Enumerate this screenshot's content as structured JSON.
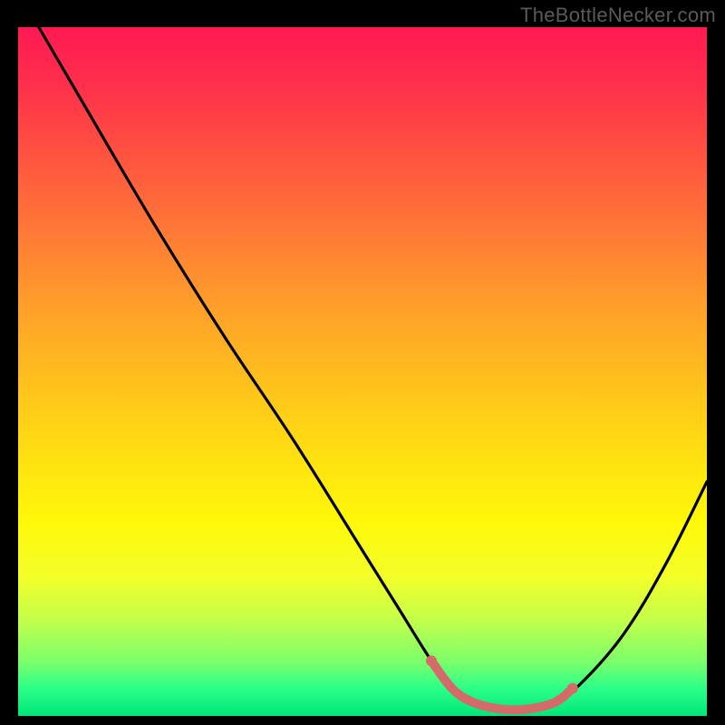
{
  "watermark": "TheBottleNecker.com",
  "colors": {
    "background": "#000000",
    "gradient_top": "#ff1a52",
    "gradient_mid": "#ffe50f",
    "gradient_bottom": "#00e67a",
    "curve": "#000000",
    "marker": "#d46a6a"
  },
  "chart_data": {
    "type": "line",
    "title": "",
    "xlabel": "",
    "ylabel": "",
    "xlim": [
      0,
      100
    ],
    "ylim": [
      0,
      100
    ],
    "x": [
      3,
      10,
      20,
      30,
      40,
      50,
      55,
      60,
      63,
      66,
      70,
      74,
      78,
      82,
      88,
      94,
      100
    ],
    "values": [
      100,
      88,
      71,
      55,
      40,
      24,
      16,
      8,
      4,
      2,
      1,
      1,
      2,
      5,
      12,
      22,
      34
    ],
    "marker_segment": {
      "x": [
        60,
        63,
        66,
        70,
        74,
        78,
        80.5
      ],
      "values": [
        8,
        4,
        2,
        1,
        1,
        2,
        4
      ]
    },
    "annotations": [],
    "legend": []
  }
}
